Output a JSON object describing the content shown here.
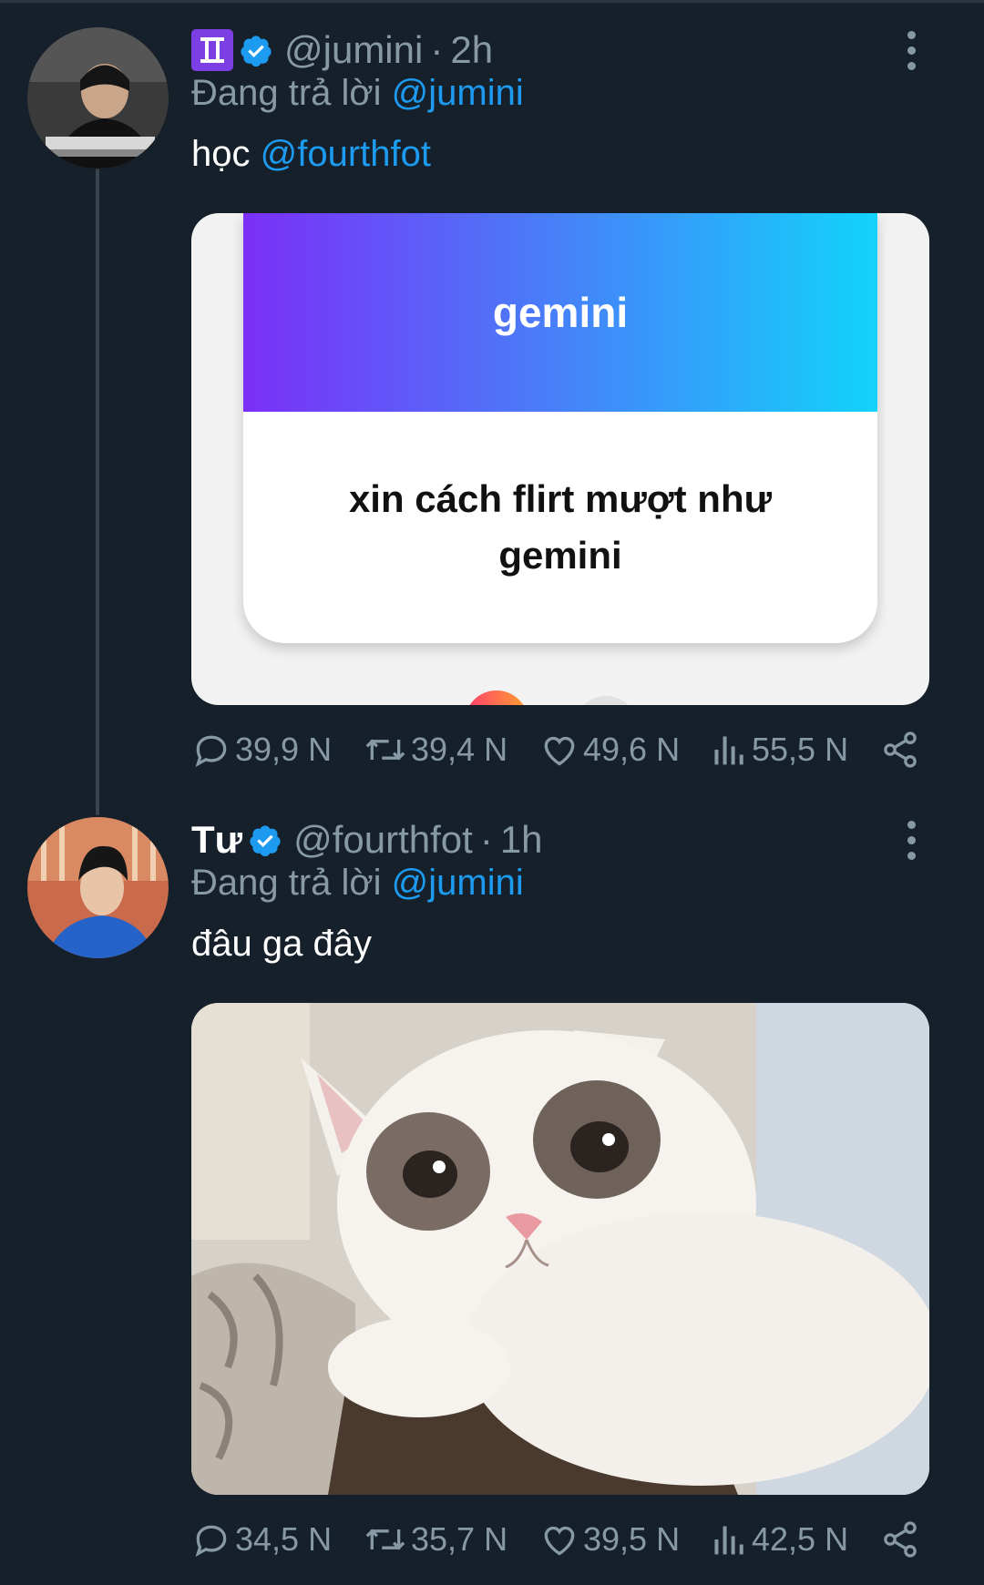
{
  "tweets": [
    {
      "display_name": "",
      "badge_glyph": "♊",
      "handle": "@jumini",
      "dot": "·",
      "time": "2h",
      "reply_prefix": "Đang trả lời",
      "reply_mention": "@jumini",
      "text": "học",
      "text_mention": "@fourthfot",
      "card": {
        "header": "gemini",
        "question": "xin cách flirt mượt như gemini"
      },
      "stats": {
        "replies": "39,9 N",
        "retweets": "39,4 N",
        "likes": "49,6 N",
        "views": "55,5 N"
      }
    },
    {
      "display_name": "Tư",
      "handle": "@fourthfot",
      "dot": "·",
      "time": "1h",
      "reply_prefix": "Đang trả lời",
      "reply_mention": "@jumini",
      "text": "đâu ga đây",
      "stats": {
        "replies": "34,5 N",
        "retweets": "35,7 N",
        "likes": "39,5 N",
        "views": "42,5 N"
      }
    }
  ],
  "icons": {
    "verified": "verified-badge-icon",
    "more": "more-vertical-icon",
    "reply": "reply-bubble-icon",
    "retweet": "retweet-icon",
    "like": "heart-icon",
    "views": "views-bars-icon",
    "share": "share-icon"
  },
  "colors": {
    "background": "#15202b",
    "mention": "#1d9bf0",
    "muted": "#8899a6",
    "verified": "#1d9bf0",
    "gemini_gradient_start": "#7b2ff7",
    "gemini_gradient_end": "#12d3fb"
  }
}
